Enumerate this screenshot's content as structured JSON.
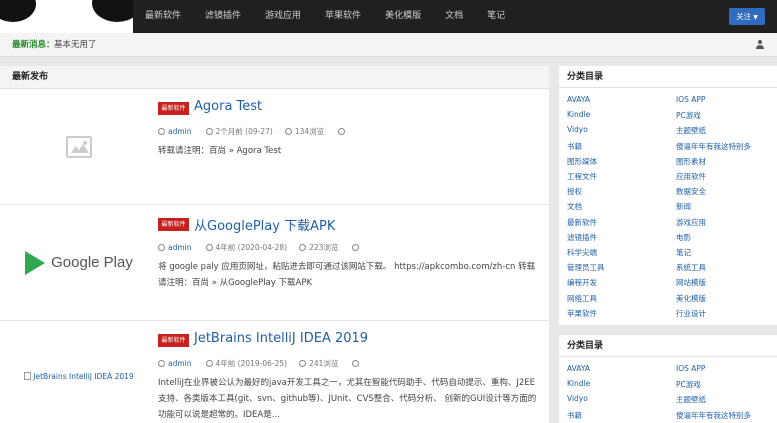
{
  "nav": {
    "items": [
      "最新软件",
      "滤镜插件",
      "游戏应用",
      "苹果软件",
      "美化模版",
      "文档",
      "笔记"
    ],
    "follow_label": "关注"
  },
  "ticker": {
    "label": "最新消息：",
    "text": "基本无用了"
  },
  "main": {
    "header": "最新发布",
    "posts": [
      {
        "badge": "最新软件",
        "title": "Agora Test",
        "author": "admin",
        "time": "2个月前 (09-27)",
        "views": "134浏览",
        "excerpt": "转载请注明：百尚 » Agora Test",
        "thumb_text": ""
      },
      {
        "badge": "最新软件",
        "title": "从GooglePlay 下载APK",
        "author": "admin",
        "time": "4年前 (2020-04-28)",
        "views": "223浏览",
        "excerpt": "将 google paly 应用页网址，粘贴进去即可通过该网站下载。 https://apkcombo.com/zh-cn 转载请注明：百尚 » 从GooglePlay 下载APK",
        "thumb_text": "Google Play"
      },
      {
        "badge": "最新软件",
        "title": "JetBrains IntelliJ IDEA 2019",
        "author": "admin",
        "time": "4年前 (2019-06-25)",
        "views": "241浏览",
        "excerpt": "IntelliJ在业界被公认为最好的java开发工具之一，尤其在智能代码助手、代码自动提示、重构、J2EE支持、各类版本工具(git、svn、github等)、JUnit、CVS整合、代码分析、 创新的GUI设计等方面的功能可以说是超常的。IDEA是...",
        "thumb_text": "JetBrains IntelliJ IDEA 2019"
      }
    ]
  },
  "sidebar": {
    "widgets": [
      {
        "title": "分类目录",
        "left": [
          "AVAYA",
          "Kindle",
          "Vidyo",
          "书籍",
          "图形媒体",
          "工程文件",
          "授权",
          "文档",
          "最新软件",
          "滤镜插件",
          "科学尖端",
          "管理员工具",
          "编程开发",
          "网络工具",
          "苹果软件"
        ],
        "right": [
          "IOS APP",
          "PC游戏",
          "主题壁纸",
          "傻逼年年有我这特别多",
          "图形素材",
          "应用软件",
          "数据安全",
          "新闻",
          "游戏应用",
          "电影",
          "笔记",
          "系统工具",
          "网站模版",
          "美化模版",
          "行业设计"
        ]
      },
      {
        "title": "分类目录",
        "left": [
          "AVAYA",
          "Kindle",
          "Vidyo",
          "书籍"
        ],
        "right": [
          "IOS APP",
          "PC游戏",
          "主题壁纸",
          "傻逼年年有我这特别多"
        ]
      }
    ]
  },
  "colors": {
    "topbar": "#202020",
    "accent_blue": "#1f5fa8",
    "badge_red": "#c8201d",
    "ticker_green": "#2a8a2a",
    "follow_button": "#2f6bbf"
  }
}
